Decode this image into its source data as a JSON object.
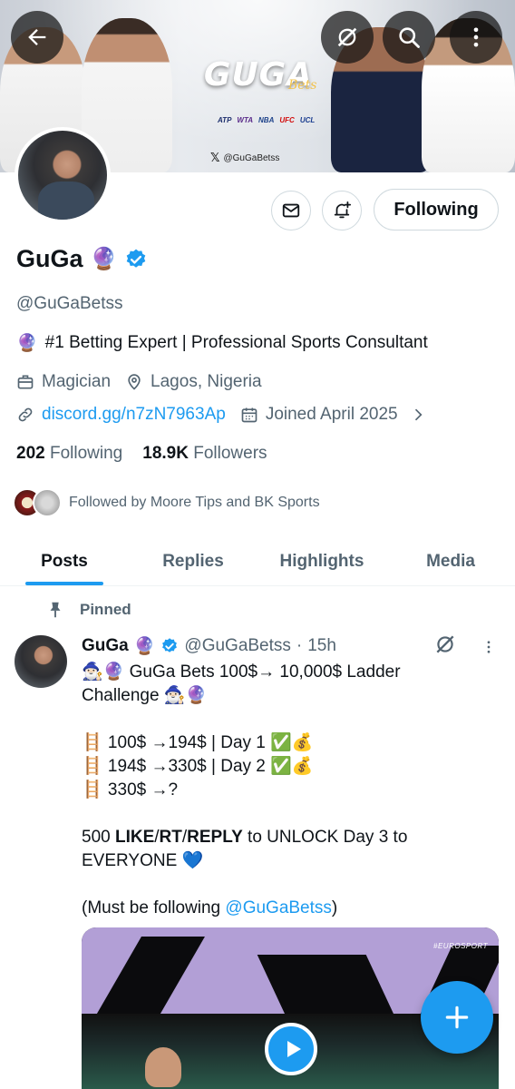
{
  "banner": {
    "logo_text": "GUGA",
    "logo_sub": "Bets",
    "leagues": [
      "ATP",
      "WTA",
      "NBA",
      "UFC",
      "UCL"
    ],
    "handle": "@GuGaBetss"
  },
  "top_bar": {
    "back_icon": "arrow-left-icon",
    "grok_icon": "grok-icon",
    "search_icon": "search-icon",
    "more_icon": "more-vertical-icon"
  },
  "actions": {
    "message_icon": "envelope-icon",
    "notify_icon": "bell-plus-icon",
    "follow_label": "Following"
  },
  "profile": {
    "name": "GuGa",
    "name_emoji": "🔮",
    "handle": "@GuGaBetss",
    "bio_emoji": "🔮",
    "bio": "#1 Betting Expert | Professional Sports Consultant",
    "occupation": "Magician",
    "location": "Lagos, Nigeria",
    "website": "discord.gg/n7zN7963Ap",
    "joined": "Joined April 2025",
    "following_count": "202",
    "following_label": "Following",
    "followers_count": "18.9K",
    "followers_label": "Followers",
    "followed_by": "Followed by Moore Tips and BK Sports"
  },
  "tabs": [
    "Posts",
    "Replies",
    "Highlights",
    "Media"
  ],
  "post": {
    "pinned_label": "Pinned",
    "author_name": "GuGa",
    "author_emoji": "🔮",
    "author_handle": "@GuGaBetss",
    "separator": "·",
    "time": "15h",
    "lines": [
      "🧙🏻‍♂️🔮 GuGa Bets 100$→ 10,000$ Ladder",
      "Challenge 🧙🏻‍♂️🔮",
      "",
      "🪜 100$ →194$ | Day 1 ✅💰",
      "🪜 194$ →330$ | Day 2 ✅💰",
      "🪜 330$ →?",
      ""
    ],
    "cta_prefix": "500 ",
    "cta_like": "LIKE",
    "cta_slash1": "/",
    "cta_rt": "RT",
    "cta_slash2": "/",
    "cta_reply": "REPLY",
    "cta_suffix": " to UNLOCK Day 3 to",
    "cta_line2": "EVERYONE 💙",
    "note_prefix": "(Must be following ",
    "note_mention": "@GuGaBetss",
    "note_suffix": ")",
    "media_watermark": "#EUROSPORT"
  },
  "fab_icon": "plus-icon",
  "colors": {
    "accent": "#1d9bf0",
    "secondary_text": "#536471",
    "primary_text": "#0f1419"
  }
}
